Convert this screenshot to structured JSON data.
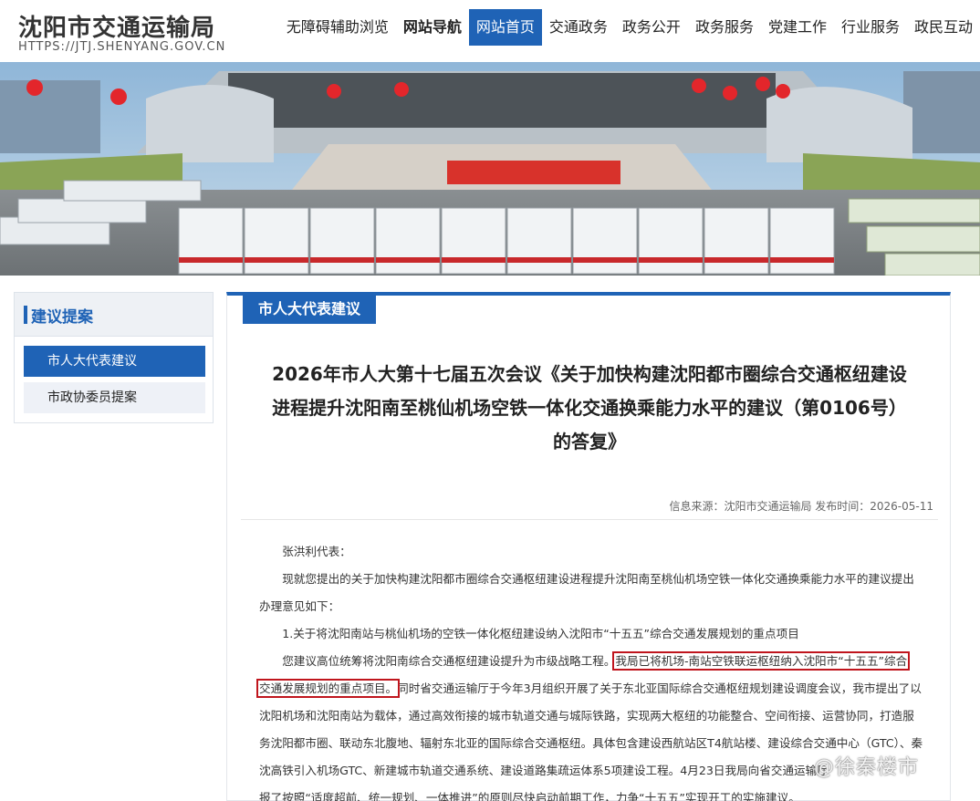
{
  "header": {
    "title": "沈阳市交通运输局",
    "url": "HTTPS://JTJ.SHENYANG.GOV.CN"
  },
  "nav": {
    "items": [
      {
        "label": "无障碍辅助浏览"
      },
      {
        "label": "网站导航"
      },
      {
        "label": "网站首页"
      },
      {
        "label": "交通政务"
      },
      {
        "label": "政务公开"
      },
      {
        "label": "政务服务"
      },
      {
        "label": "党建工作"
      },
      {
        "label": "行业服务"
      },
      {
        "label": "政民互动"
      }
    ],
    "active": "网站首页"
  },
  "sidebar": {
    "title": "建议提案",
    "items": [
      {
        "label": "市人大代表建议"
      },
      {
        "label": "市政协委员提案"
      }
    ]
  },
  "panel": {
    "tab": "市人大代表建议"
  },
  "article": {
    "title_lines": [
      "2026年市人大第十七届五次会议《关于加快构建沈阳都市圈综合交通枢纽建设",
      "进程提升沈阳南至桃仙机场空铁一体化交通换乘能力水平的建议（第0106号）",
      "的答复》"
    ],
    "meta": "信息来源：沈阳市交通运输局 发布时间：2026-05-11",
    "salutation": "张洪利代表：",
    "para1": "现就您提出的关于加快构建沈阳都市圈综合交通枢纽建设进程提升沈阳南至桃仙机场空铁一体化交通换乘能力水平的建议提出办理意见如下：",
    "item1": "1.关于将沈阳南站与桃仙机场的空铁一体化枢纽建设纳入沈阳市“十五五”综合交通发展规划的重点项目",
    "para2_pre": "您建议高位统筹将沈阳南综合交通枢纽建设提升为市级战略工程。",
    "para2_hl1": "我局已将机场-南站空铁联运枢纽纳入沈阳市“十五五”综合",
    "para2_hl2": "交通发展规划的重点项目。",
    "para2_post": "同时省交通运输厅于今年3月组织开展了关于东北亚国际综合交通枢纽规划建设调度会议，我市提出了以沈阳机场和沈阳南站为载体，通过高效衔接的城市轨道交通与城际铁路，实现两大枢纽的功能整合、空间衔接、运营协同，打造服务沈阳都市圈、联动东北腹地、辐射东北亚的国际综合交通枢纽。具体包含建设西航站区T4航站楼、建设综合交通中心（GTC）、秦沈高铁引入机场GTC、新建城市轨道交通系统、建设道路集疏运体系5项建设工程。4月23日我局向省交通运输厅",
    "para2_end": "报了按照“适度超前、统一规划、一体推进”的原则尽快启动前期工作，力争“十五五”实现开工的实施建议。"
  },
  "watermark": "@徐秦楼市",
  "colors": {
    "accent": "#1f63b6",
    "highlight_border": "#c0151d"
  }
}
